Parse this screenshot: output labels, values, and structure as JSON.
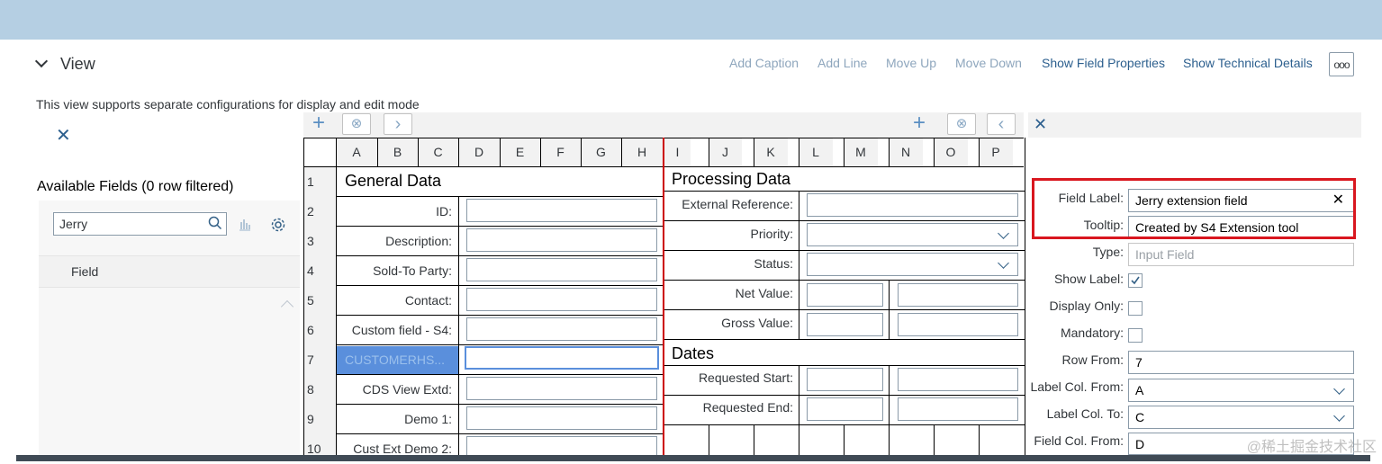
{
  "header": {
    "title": "View",
    "toolbar": {
      "add_caption": "Add Caption",
      "add_line": "Add Line",
      "move_up": "Move Up",
      "move_down": "Move Down",
      "show_field_properties": "Show Field Properties",
      "show_technical_details": "Show Technical Details",
      "overflow": "ooo"
    },
    "info_text": "This view supports separate configurations for display and edit mode"
  },
  "left_panel": {
    "title": "Available Fields (0 row filtered)",
    "search": {
      "value": "Jerry",
      "placeholder": ""
    },
    "column_header": "Field"
  },
  "grid": {
    "columns": [
      "A",
      "B",
      "C",
      "D",
      "E",
      "F",
      "G",
      "H",
      "I",
      "J",
      "K",
      "L",
      "M",
      "N",
      "O",
      "P"
    ],
    "rows": [
      "1",
      "2",
      "3",
      "4",
      "5",
      "6",
      "7",
      "8",
      "9",
      "10"
    ],
    "left_section": {
      "title": "General Data",
      "fields": [
        {
          "label": "ID:"
        },
        {
          "label": "Description:"
        },
        {
          "label": "Sold-To Party:"
        },
        {
          "label": "Contact:"
        },
        {
          "label": "Custom field - S4:"
        },
        {
          "label": "CUSTOMERHS..."
        },
        {
          "label": "CDS View Extd:"
        },
        {
          "label": "Demo 1:"
        },
        {
          "label": "Cust Ext Demo 2:"
        }
      ]
    },
    "right_section": {
      "title": "Processing Data",
      "fields": [
        {
          "label": "External Reference:"
        },
        {
          "label": "Priority:"
        },
        {
          "label": "Status:"
        },
        {
          "label": "Net Value:"
        },
        {
          "label": "Gross Value:"
        }
      ],
      "dates_title": "Dates",
      "dates_fields": [
        {
          "label": "Requested Start:"
        },
        {
          "label": "Requested End:"
        }
      ]
    }
  },
  "properties": {
    "field_label": {
      "label": "Field Label:",
      "value": "Jerry extension field"
    },
    "tooltip": {
      "label": "Tooltip:",
      "value": "Created by S4 Extension tool"
    },
    "type": {
      "label": "Type:",
      "value": "Input Field"
    },
    "show_label": {
      "label": "Show Label:",
      "checked": true
    },
    "display_only": {
      "label": "Display Only:",
      "checked": false
    },
    "mandatory": {
      "label": "Mandatory:",
      "checked": false
    },
    "row_from": {
      "label": "Row From:",
      "value": "7"
    },
    "label_col_from": {
      "label": "Label Col. From:",
      "value": "A"
    },
    "label_col_to": {
      "label": "Label Col. To:",
      "value": "C"
    },
    "field_col_from": {
      "label": "Field Col. From:",
      "value": "D"
    }
  },
  "watermark": "@稀土掘金技术社区",
  "colors": {
    "topbar": "#b5cfe3",
    "selected_cell": "#5a8fdc",
    "highlight": "#d9171f",
    "divider": "#cc0000"
  }
}
